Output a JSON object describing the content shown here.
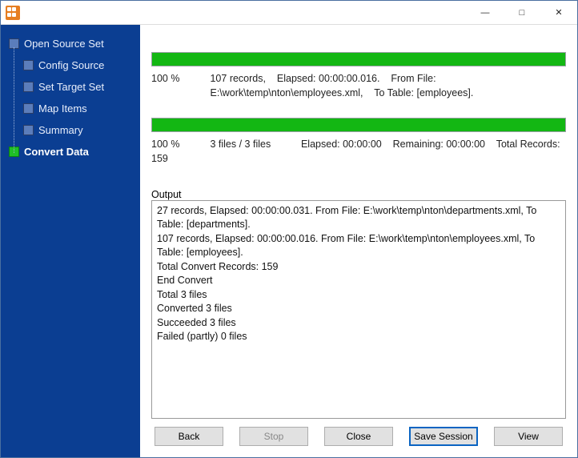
{
  "sidebar": {
    "items": [
      {
        "label": "Open Source Set",
        "active": false,
        "child": false
      },
      {
        "label": "Config Source",
        "active": false,
        "child": true
      },
      {
        "label": "Set Target Set",
        "active": false,
        "child": true
      },
      {
        "label": "Map Items",
        "active": false,
        "child": true
      },
      {
        "label": "Summary",
        "active": false,
        "child": true
      },
      {
        "label": "Convert Data",
        "active": true,
        "child": false
      }
    ]
  },
  "progress1": {
    "percent": "100 %",
    "counts": "107 records,",
    "elapsed_label": "Elapsed: 00:00:00.016.",
    "from_label": "From File:",
    "from_value": "E:\\work\\temp\\nton\\employees.xml,",
    "to_label": "To Table: [employees]."
  },
  "progress2": {
    "percent": "100 %",
    "counts": "3 files / 3 files",
    "elapsed_label": "Elapsed: 00:00:00",
    "remaining_label": "Remaining: 00:00:00",
    "total_label": "Total Records: 159"
  },
  "output": {
    "label": "Output",
    "lines": [
      "27 records,    Elapsed: 00:00:00.031.    From File: E:\\work\\temp\\nton\\departments.xml,    To Table: [departments].",
      "107 records,    Elapsed: 00:00:00.016.    From File: E:\\work\\temp\\nton\\employees.xml,    To Table: [employees].",
      "Total Convert Records: 159",
      "End Convert",
      "Total 3 files",
      "Converted 3 files",
      "Succeeded 3 files",
      "Failed (partly) 0 files"
    ]
  },
  "buttons": {
    "back": "Back",
    "stop": "Stop",
    "close": "Close",
    "save_session": "Save Session",
    "view": "View"
  },
  "window_controls": {
    "minimize": "—",
    "maximize": "□",
    "close": "✕"
  }
}
